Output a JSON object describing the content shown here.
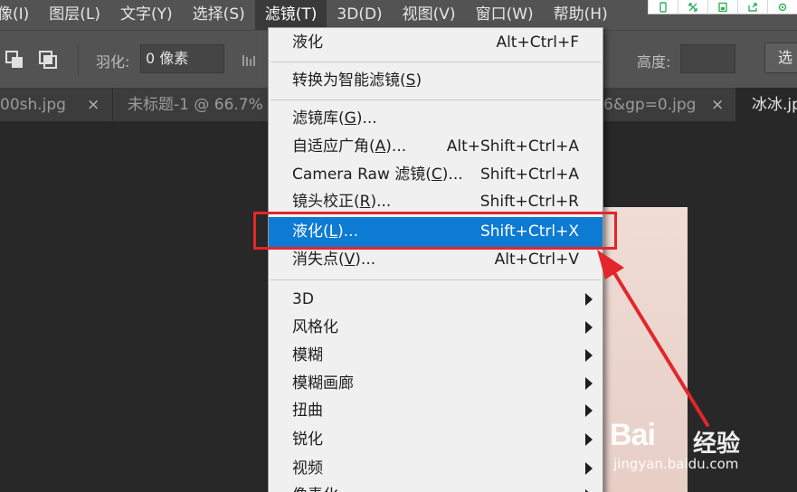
{
  "menubar": {
    "items": [
      "像(I)",
      "图层(L)",
      "文字(Y)",
      "选择(S)",
      "滤镜(T)",
      "3D(D)",
      "视图(V)",
      "窗口(W)",
      "帮助(H)"
    ]
  },
  "options": {
    "feather_label": "羽化:",
    "feather_value": "0 像素",
    "height_label": "高度:",
    "right_button": "选"
  },
  "tabs": [
    {
      "label": "00sh.jpg",
      "close": "×"
    },
    {
      "label": "未标题-1 @ 66.7%",
      "close": ""
    },
    {
      "label": "6&gp=0.jpg",
      "close": "×"
    },
    {
      "label": "冰冰.jp",
      "close": ""
    }
  ],
  "filter_menu": {
    "items": [
      {
        "label": "液化",
        "shortcut": "Alt+Ctrl+F"
      },
      {
        "label_pre": "转换为智能滤镜(",
        "key": "S",
        "label_post": ")"
      },
      {
        "label_pre": "滤镜库(",
        "key": "G",
        "label_post": ")..."
      },
      {
        "label_pre": "自适应广角(",
        "key": "A",
        "label_post": ")...",
        "shortcut": "Alt+Shift+Ctrl+A"
      },
      {
        "label_pre": "Camera Raw 滤镜(",
        "key": "C",
        "label_post": ")...",
        "shortcut": "Shift+Ctrl+A"
      },
      {
        "label_pre": "镜头校正(",
        "key": "R",
        "label_post": ")...",
        "shortcut": "Shift+Ctrl+R"
      },
      {
        "label_pre": "液化(",
        "key": "L",
        "label_post": ")...",
        "shortcut": "Shift+Ctrl+X"
      },
      {
        "label_pre": "消失点(",
        "key": "V",
        "label_post": ")...",
        "shortcut": "Alt+Ctrl+V"
      },
      {
        "label": "3D"
      },
      {
        "label": "风格化"
      },
      {
        "label": "模糊"
      },
      {
        "label": "模糊画廊"
      },
      {
        "label": "扭曲"
      },
      {
        "label": "锐化"
      },
      {
        "label": "视频"
      },
      {
        "label": "像素化"
      }
    ]
  },
  "watermark": {
    "logo": "Bai",
    "logo_suffix": "经验",
    "url": "jingyan.baidu.com"
  },
  "colors": {
    "accent": "#0d7ad3",
    "highlight_border": "#e3262b",
    "menubar_bg": "#535353",
    "menu_bg": "#f0f0f0"
  },
  "icons": [
    "ribbon-phone-icon",
    "ribbon-expand-icon",
    "ribbon-save-icon",
    "ribbon-share-icon",
    "ribbon-settings-icon",
    "intersect-selection-icon",
    "subtract-selection-icon",
    "submenu-arrow-icon"
  ]
}
